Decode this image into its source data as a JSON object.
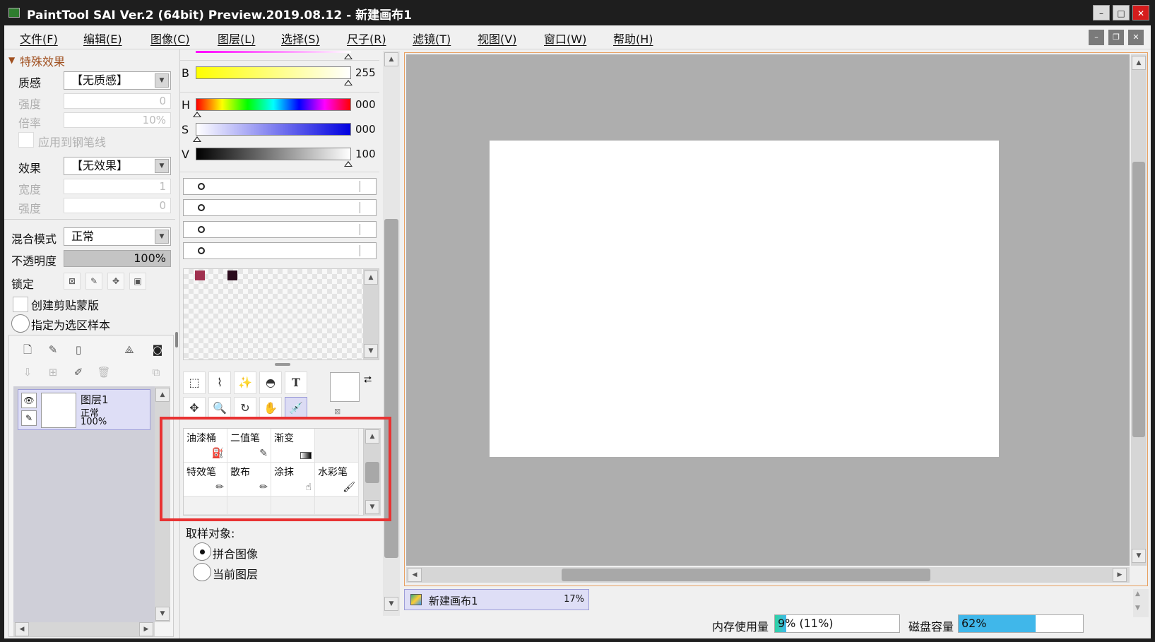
{
  "window": {
    "title": "PaintTool SAI Ver.2 (64bit) Preview.2019.08.12 - 新建画布1",
    "min_glyph": "–",
    "max_glyph": "□",
    "close_glyph": "✕"
  },
  "menu": {
    "items": [
      "文件(F)",
      "编辑(E)",
      "图像(C)",
      "图层(L)",
      "选择(S)",
      "尺子(R)",
      "滤镜(T)",
      "视图(V)",
      "窗口(W)",
      "帮助(H)"
    ]
  },
  "effects": {
    "section_title": "特殊效果",
    "texture_label": "质感",
    "texture_value": "【无质感】",
    "strength_label": "强度",
    "strength_value": "0",
    "scale_label": "倍率",
    "scale_value": "10%",
    "apply_pen_label": "应用到钢笔线",
    "effect_label": "效果",
    "effect_value": "【无效果】",
    "width_label": "宽度",
    "width_value": "1",
    "effect_strength_label": "强度",
    "effect_strength_value": "0"
  },
  "layer_props": {
    "blend_label": "混合模式",
    "blend_value": "正常",
    "opacity_label": "不透明度",
    "opacity_value": "100%",
    "opacity_fraction": 1.0,
    "lock_label": "锁定",
    "clip_label": "创建剪贴蒙版",
    "sample_label": "指定为选区样本"
  },
  "layers": [
    {
      "name": "图层1",
      "mode": "正常",
      "opacity": "100%"
    }
  ],
  "color": {
    "b_label": "B",
    "b_value": "255",
    "h_label": "H",
    "h_value": "000",
    "s_label": "S",
    "s_value": "000",
    "v_label": "V",
    "v_value": "100",
    "swatches": [
      "#a0304f",
      "#2a0a1c"
    ]
  },
  "brushes": [
    {
      "name": "油漆桶",
      "icon": "bucket-icon"
    },
    {
      "name": "二值笔",
      "icon": "binary-pen-icon"
    },
    {
      "name": "渐变",
      "icon": "gradient-icon"
    },
    {
      "name": "",
      "icon": ""
    },
    {
      "name": "特效笔",
      "icon": "effect-pen-icon"
    },
    {
      "name": "散布",
      "icon": "scatter-icon"
    },
    {
      "name": "涂抹",
      "icon": "smudge-icon"
    },
    {
      "name": "水彩笔",
      "icon": "watercolor-icon"
    }
  ],
  "sampling": {
    "label": "取样对象:",
    "opt1": "拼合图像",
    "opt2": "当前图层"
  },
  "canvas": {
    "tab_name": "新建画布1",
    "zoom": "17%",
    "bg": "#aeaeae"
  },
  "status": {
    "memory_label": "内存使用量",
    "memory_value": "9% (11%)",
    "memory_fraction": 0.09,
    "disk_label": "磁盘容量",
    "disk_value": "62%",
    "disk_fraction": 0.62
  }
}
